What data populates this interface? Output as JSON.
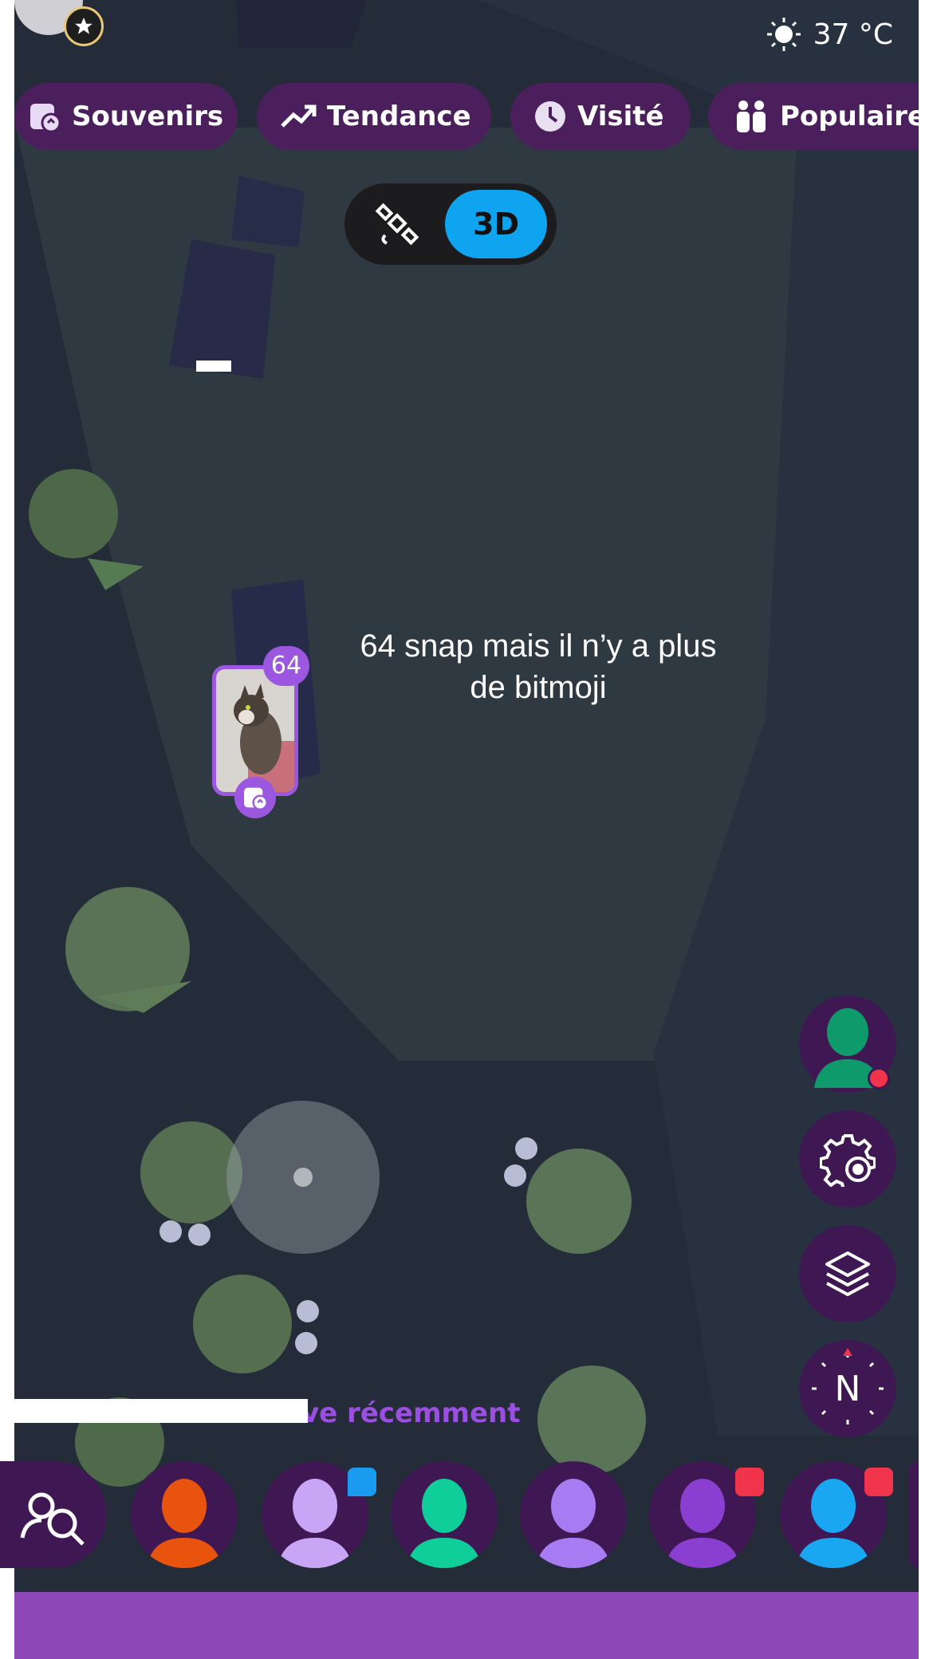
{
  "status": {
    "temperature": "37 °C"
  },
  "filters": [
    {
      "label": "Souvenirs",
      "icon": "memories-icon"
    },
    {
      "label": "Tendance",
      "icon": "trending-icon"
    },
    {
      "label": "Visité",
      "icon": "clock-icon"
    },
    {
      "label": "Populaires",
      "icon": "people-icon"
    }
  ],
  "view_toggle": {
    "satellite_icon": "satellite-icon",
    "mode_label": "3D"
  },
  "caption": {
    "line1": "64 snap mais il n’y a plus",
    "line2": "de bitmoji"
  },
  "snap_marker": {
    "count": "64",
    "icon": "memories-icon"
  },
  "side_buttons": [
    "bitmoji-icon",
    "settings-location-icon",
    "layers-icon",
    "compass-icon"
  ],
  "compass": {
    "label": "N"
  },
  "recent": {
    "label": "ve récemment"
  },
  "friends": [
    {
      "name": "search-friends",
      "color": "#3f1853"
    },
    {
      "name": "friend-1",
      "color": "#e8530e"
    },
    {
      "name": "friend-2",
      "color": "#c9a6f5",
      "badge": "#1a9bf0"
    },
    {
      "name": "friend-3",
      "color": "#0fce9a"
    },
    {
      "name": "friend-4",
      "color": "#a77cf3"
    },
    {
      "name": "friend-5",
      "color": "#8b3fd0",
      "badge": "#f0344c"
    },
    {
      "name": "friend-6",
      "color": "#1aa7f2",
      "badge": "#f0344c"
    }
  ],
  "colors": {
    "accent": "#8e48b8",
    "chip_bg": "#4a1f5c",
    "toggle_active": "#0fa4f0"
  }
}
